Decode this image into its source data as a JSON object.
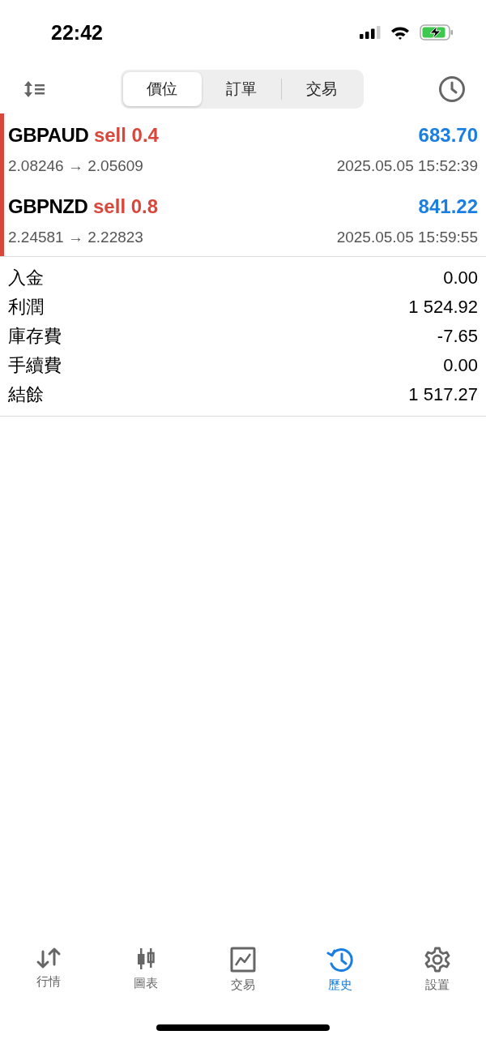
{
  "status_bar": {
    "time": "22:42"
  },
  "segments": [
    {
      "label": "價位",
      "selected": true
    },
    {
      "label": "訂單",
      "selected": false
    },
    {
      "label": "交易",
      "selected": false
    }
  ],
  "deals": [
    {
      "symbol": "GBPAUD",
      "kind": "sell",
      "volume": "sell 0.4",
      "profit": "683.70",
      "prices": "2.08246 → 2.05609",
      "time": "2025.05.05 15:52:39"
    },
    {
      "symbol": "GBPNZD",
      "kind": "sell",
      "volume": "sell 0.8",
      "profit": "841.22",
      "prices": "2.24581 → 2.22823",
      "time": "2025.05.05 15:59:55"
    }
  ],
  "summary": [
    {
      "label": "入金",
      "value": "0.00"
    },
    {
      "label": "利潤",
      "value": "1 524.92"
    },
    {
      "label": "庫存費",
      "value": "-7.65"
    },
    {
      "label": "手續費",
      "value": "0.00"
    },
    {
      "label": "結餘",
      "value": "1 517.27"
    }
  ],
  "tab_bar": [
    {
      "kind": "quotes",
      "label": "行情",
      "selected": false
    },
    {
      "kind": "chart",
      "label": "圖表",
      "selected": false
    },
    {
      "kind": "trade",
      "label": "交易",
      "selected": false
    },
    {
      "kind": "history",
      "label": "歷史",
      "selected": true
    },
    {
      "kind": "settings",
      "label": "設置",
      "selected": false
    }
  ]
}
